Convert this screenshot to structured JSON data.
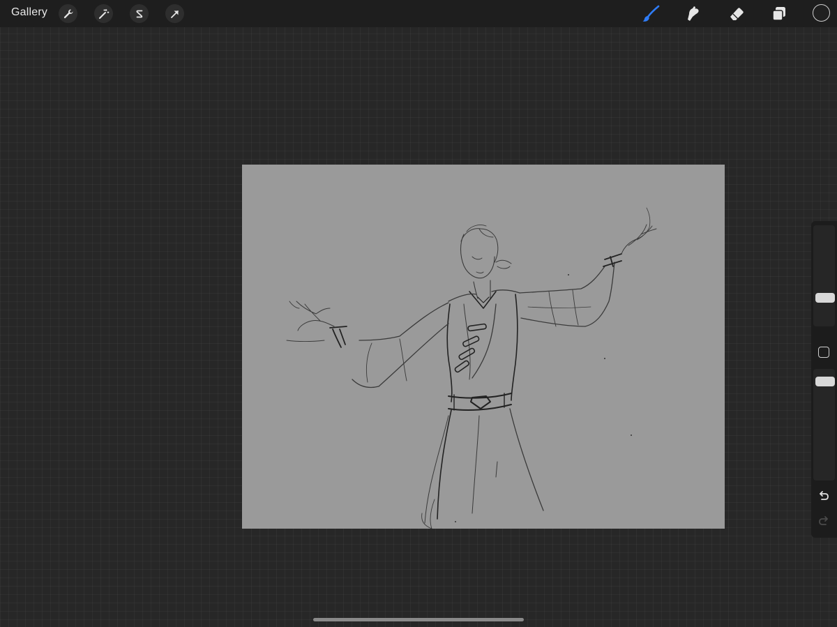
{
  "topbar": {
    "gallery_label": "Gallery",
    "left_tools": [
      {
        "name": "actions",
        "icon": "wrench-icon"
      },
      {
        "name": "adjustments",
        "icon": "magic-wand-icon"
      },
      {
        "name": "selection",
        "icon": "selection-s-icon"
      },
      {
        "name": "transform",
        "icon": "arrow-cursor-icon"
      }
    ],
    "right_tools": [
      {
        "name": "brush",
        "icon": "brush-icon",
        "active": true
      },
      {
        "name": "smudge",
        "icon": "smudge-icon",
        "active": false
      },
      {
        "name": "eraser",
        "icon": "eraser-icon",
        "active": false
      },
      {
        "name": "layers",
        "icon": "layers-icon",
        "active": false
      }
    ],
    "current_color": "#202020"
  },
  "canvas": {
    "background_color": "#9a9a9a",
    "content": "pencil-sketch"
  },
  "sidebar": {
    "brush_size_level": 0.74,
    "opacity_level": 0.93,
    "undo_icon": "undo-icon",
    "redo_icon": "redo-icon"
  },
  "colors": {
    "accent": "#2f7cf6",
    "toolbar_bg": "#1e1e1e",
    "workspace_bg": "#272727"
  }
}
